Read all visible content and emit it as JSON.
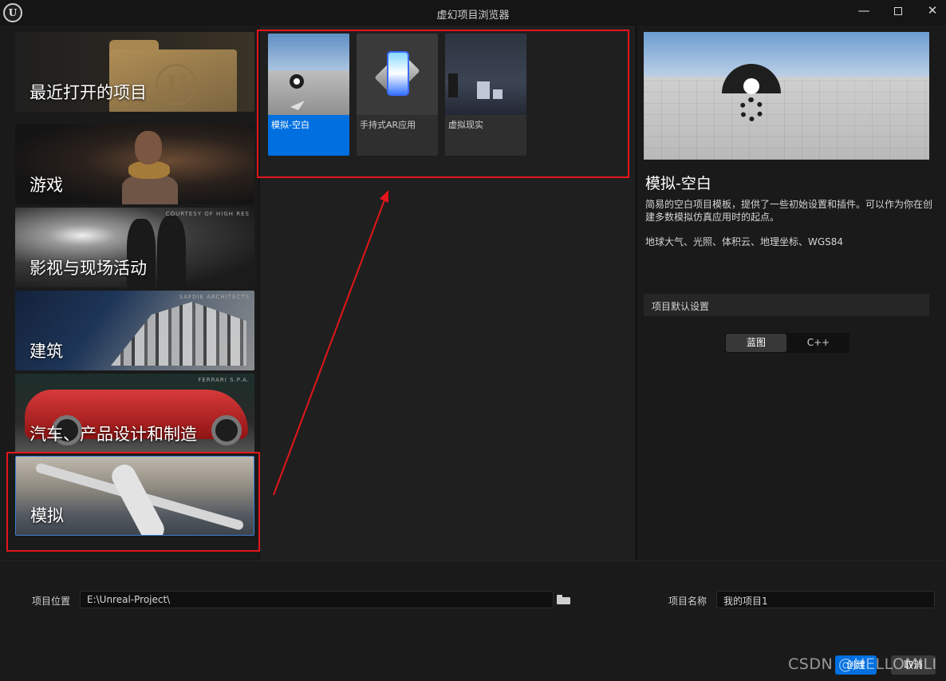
{
  "window": {
    "title": "虚幻项目浏览器",
    "controls": {
      "minimize": "—",
      "close": "✕"
    }
  },
  "categories": [
    {
      "label": "最近打开的项目",
      "credit": ""
    },
    {
      "label": "游戏",
      "credit": ""
    },
    {
      "label": "影视与现场活动",
      "credit": "COURTESY OF HIGH RES"
    },
    {
      "label": "建筑",
      "credit": "SAFDIE ARCHITECTS"
    },
    {
      "label": "汽车、产品设计和制造",
      "credit": "FERRARI S.P.A."
    },
    {
      "label": "模拟",
      "credit": "",
      "selected": true
    }
  ],
  "templates": [
    {
      "name": "模拟-空白",
      "selected": true
    },
    {
      "name": "手持式AR应用",
      "selected": false
    },
    {
      "name": "虚拟现实",
      "selected": false
    }
  ],
  "details": {
    "title": "模拟-空白",
    "description": "简易的空白项目模板，提供了一些初始设置和插件。可以作为你在创建多数模拟仿真应用时的起点。",
    "features": "地球大气、光照、体积云、地理坐标、WGS84",
    "settings_header": "项目默认设置",
    "code_options": [
      "蓝图",
      "C++"
    ],
    "selected_option": "蓝图"
  },
  "bottom": {
    "location_label": "项目位置",
    "location_value": "E:\\Unreal-Project\\",
    "name_label": "项目名称",
    "name_value": "我的项目1",
    "create_label": "创建",
    "cancel_label": "取消"
  },
  "watermark": "CSDN @HELLOMILI",
  "colors": {
    "accent": "#0070e0",
    "annotation_red": "#e3161b",
    "background": "#1a1a1a"
  },
  "icons": [
    "unreal-logo-icon",
    "folder-icon",
    "arrow-annotation-icon"
  ]
}
